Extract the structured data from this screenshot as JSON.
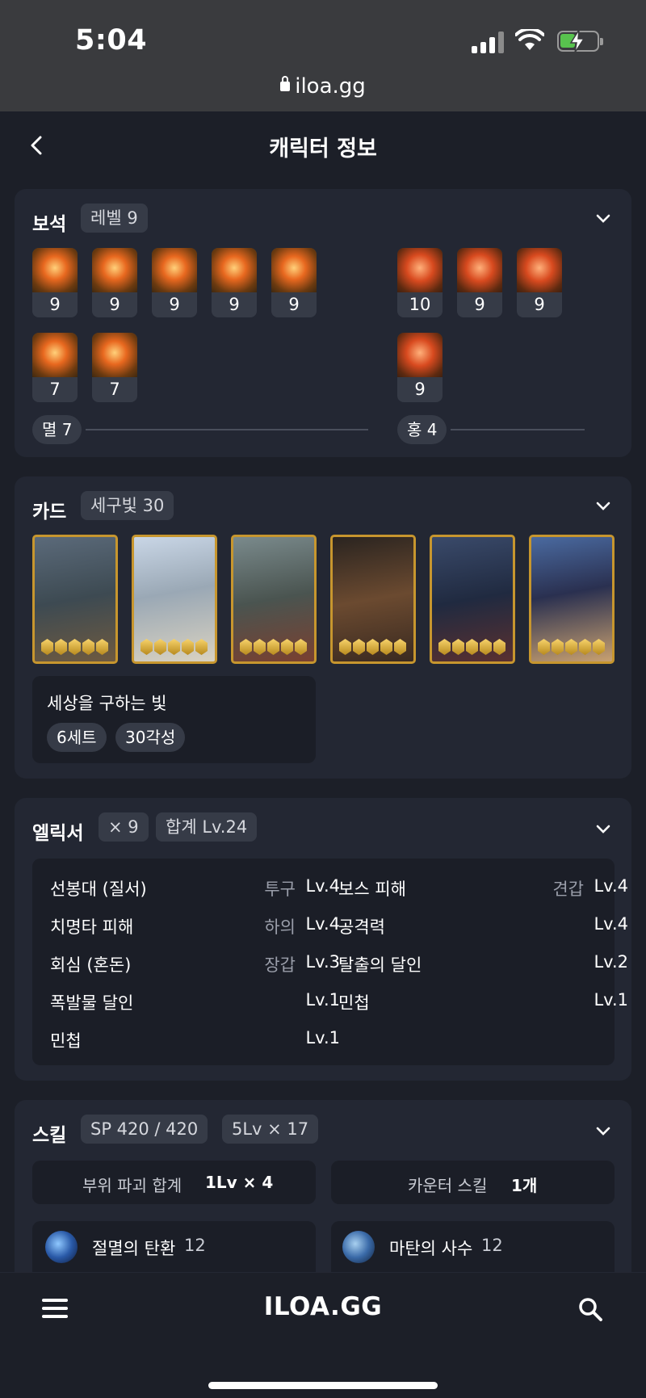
{
  "status": {
    "time": "5:04",
    "url": "iloa.gg"
  },
  "header": {
    "title": "캐릭터 정보"
  },
  "gems": {
    "title": "보석",
    "level_chip": "레벨 9",
    "myul_levels": [
      "9",
      "9",
      "9",
      "9",
      "9",
      "7",
      "7"
    ],
    "hong_levels": [
      "10",
      "9",
      "9",
      "9"
    ],
    "myul_count": "멸 7",
    "hong_count": "홍 4"
  },
  "cards": {
    "title": "카드",
    "set_chip": "세구빛 30",
    "set_name": "세상을 구하는 빛",
    "set_count": "6세트",
    "awaken": "30각성",
    "awaken_gems_per_card": 5
  },
  "elixir": {
    "title": "엘릭서",
    "count_chip": "× 9",
    "total_chip": "합계 Lv.24",
    "left": [
      {
        "name": "선봉대 (질서)",
        "part": "투구",
        "level": "Lv.4"
      },
      {
        "name": "치명타 피해",
        "part": "하의",
        "level": "Lv.4"
      },
      {
        "name": "회심 (혼돈)",
        "part": "장갑",
        "level": "Lv.3"
      },
      {
        "name": "폭발물 달인",
        "part": "",
        "level": "Lv.1"
      },
      {
        "name": "민첩",
        "part": "",
        "level": "Lv.1"
      }
    ],
    "right": [
      {
        "name": "보스 피해",
        "part": "견갑",
        "level": "Lv.4"
      },
      {
        "name": "공격력",
        "part": "",
        "level": "Lv.4"
      },
      {
        "name": "탈출의 달인",
        "part": "",
        "level": "Lv.2"
      },
      {
        "name": "민첩",
        "part": "",
        "level": "Lv.1"
      }
    ]
  },
  "skills": {
    "title": "스킬",
    "sp_chip": "SP 420 / 420",
    "lv_chip": "5Lv × 17",
    "break_label": "부위 파괴 합계",
    "break_value": "1Lv × 4",
    "counter_label": "카운터 스킬",
    "counter_value": "1개",
    "items": [
      {
        "name": "절멸의 탄환",
        "level": "12"
      },
      {
        "name": "마탄의 사수",
        "level": "12"
      }
    ]
  },
  "bottom": {
    "logo": "ILOA.GG"
  },
  "colors": {
    "background": "#1c1f28",
    "card": "#232733",
    "chip": "#363b47",
    "card_frame": "#c7962e"
  }
}
